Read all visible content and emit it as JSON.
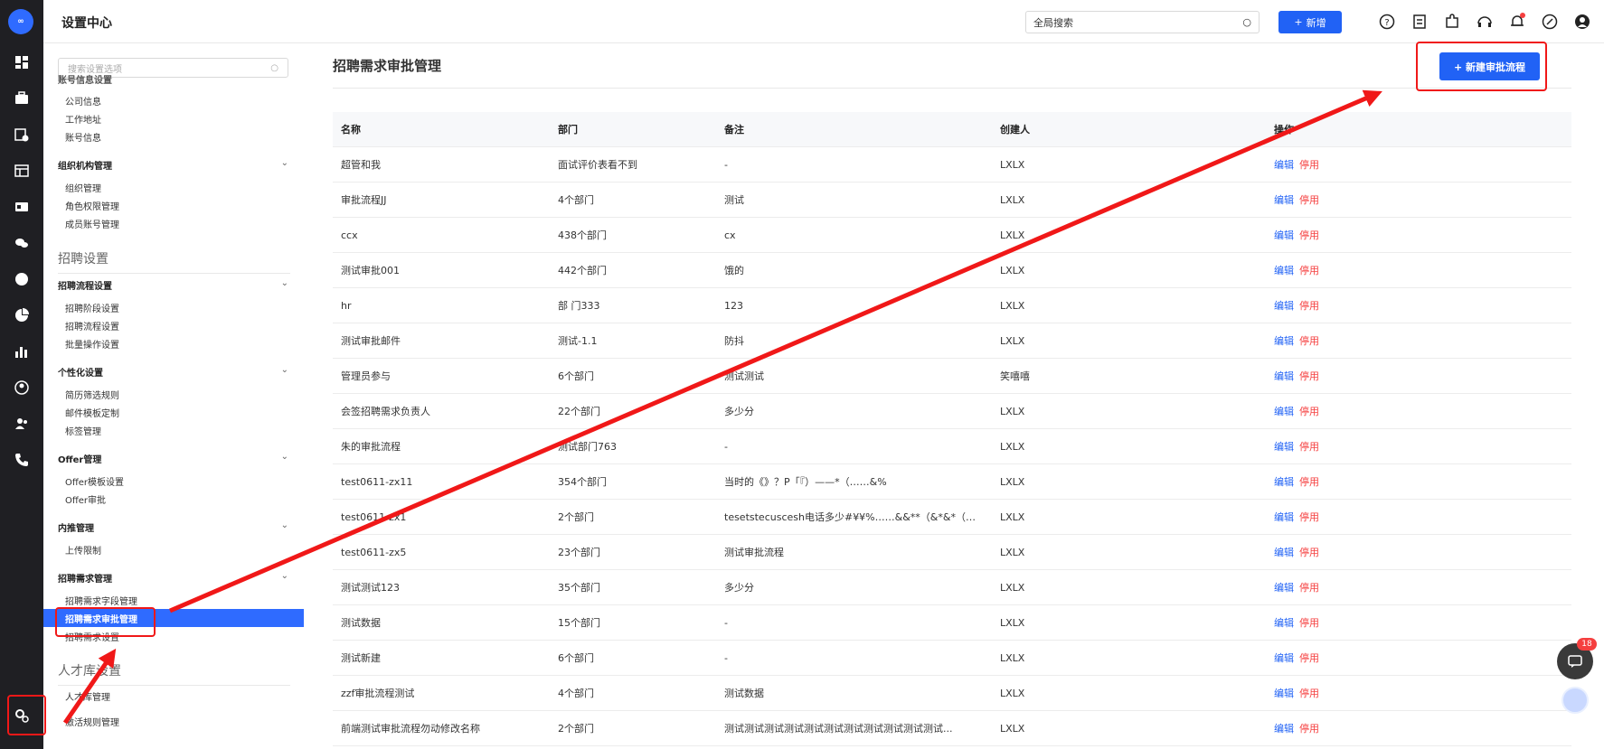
{
  "header": {
    "title": "设置中心",
    "search_placeholder": "全局搜索",
    "add_label": "新增",
    "notification_color": "#f53f3f"
  },
  "sidebar": {
    "search_placeholder": "搜索设置选项",
    "cut_group": "账号信息设置",
    "groups": [
      {
        "label": "组织机构管理"
      },
      {
        "label": "招聘流程设置"
      },
      {
        "label": "个性化设置"
      },
      {
        "label": "Offer管理"
      },
      {
        "label": "内推管理"
      },
      {
        "label": "招聘需求管理"
      }
    ],
    "items": {
      "company_info": "公司信息",
      "work_address": "工作地址",
      "account_info": "账号信息",
      "org_manage": "组织管理",
      "role_perm": "角色权限管理",
      "member_account": "成员账号管理",
      "stage_setting": "招聘阶段设置",
      "flow_setting": "招聘流程设置",
      "batch_setting": "批量操作设置",
      "resume_filter": "简历筛选规则",
      "mail_template": "邮件模板定制",
      "tag_manage": "标签管理",
      "offer_template": "Offer模板设置",
      "offer_approve": "Offer审批",
      "upload_limit": "上传限制",
      "field_manage": "招聘需求字段管理",
      "approval_manage": "招聘需求审批管理",
      "demand_setting": "招聘需求设置",
      "talent_manage": "人才库管理",
      "activate_rule": "激活规则管理"
    },
    "sections": {
      "recruit": "招聘设置",
      "talent": "人才库设置"
    }
  },
  "main": {
    "title": "招聘需求审批管理",
    "new_button": "+ 新建审批流程",
    "columns": [
      "名称",
      "部门",
      "备注",
      "创建人",
      "操作"
    ],
    "edit_label": "编辑",
    "stop_label": "停用",
    "rows": [
      {
        "name": "超管和我",
        "dept": "面试评价表看不到",
        "note": "-",
        "creator": "LXLX"
      },
      {
        "name": "审批流程JJ",
        "dept": "4个部门",
        "note": "测试",
        "creator": "LXLX"
      },
      {
        "name": "ccx",
        "dept": "438个部门",
        "note": "cx",
        "creator": "LXLX"
      },
      {
        "name": "测试审批001",
        "dept": "442个部门",
        "note": "饿的",
        "creator": "LXLX"
      },
      {
        "name": "hr",
        "dept": "部 门333",
        "note": "123",
        "creator": "LXLX"
      },
      {
        "name": "测试审批邮件",
        "dept": "测试-1.1",
        "note": "防抖",
        "creator": "LXLX"
      },
      {
        "name": "管理员参与",
        "dept": "6个部门",
        "note": "测试测试",
        "creator": "笑嘻嘻"
      },
      {
        "name": "会签招聘需求负责人",
        "dept": "22个部门",
        "note": "多少分",
        "creator": "LXLX"
      },
      {
        "name": "朱的审批流程",
        "dept": "测试部门763",
        "note": "-",
        "creator": "LXLX"
      },
      {
        "name": "test0611-zx11",
        "dept": "354个部门",
        "note": "当时的《》？P「『）——*（……&%",
        "creator": "LXLX"
      },
      {
        "name": "test0611-zx1",
        "dept": "2个部门",
        "note": "tesetstecuscesh电话多少#¥¥%……&&**（&*&*（》？“...",
        "creator": "LXLX"
      },
      {
        "name": "test0611-zx5",
        "dept": "23个部门",
        "note": "测试审批流程",
        "creator": "LXLX"
      },
      {
        "name": "测试测试123",
        "dept": "35个部门",
        "note": "多少分",
        "creator": "LXLX"
      },
      {
        "name": "测试数据",
        "dept": "15个部门",
        "note": "-",
        "creator": "LXLX"
      },
      {
        "name": "测试新建",
        "dept": "6个部门",
        "note": "-",
        "creator": "LXLX"
      },
      {
        "name": "zzf审批流程测试",
        "dept": "4个部门",
        "note": "测试数据",
        "creator": "LXLX"
      },
      {
        "name": "前端测试审批流程勿动修改名称",
        "dept": "2个部门",
        "note": "测试测试测试测试测试测试测试测试测试测试测试...",
        "creator": "LXLX"
      }
    ]
  },
  "floating": {
    "chat_badge": "18"
  },
  "colors": {
    "primary": "#2162f5",
    "danger": "#f53f3f",
    "annotation": "#f01818"
  }
}
